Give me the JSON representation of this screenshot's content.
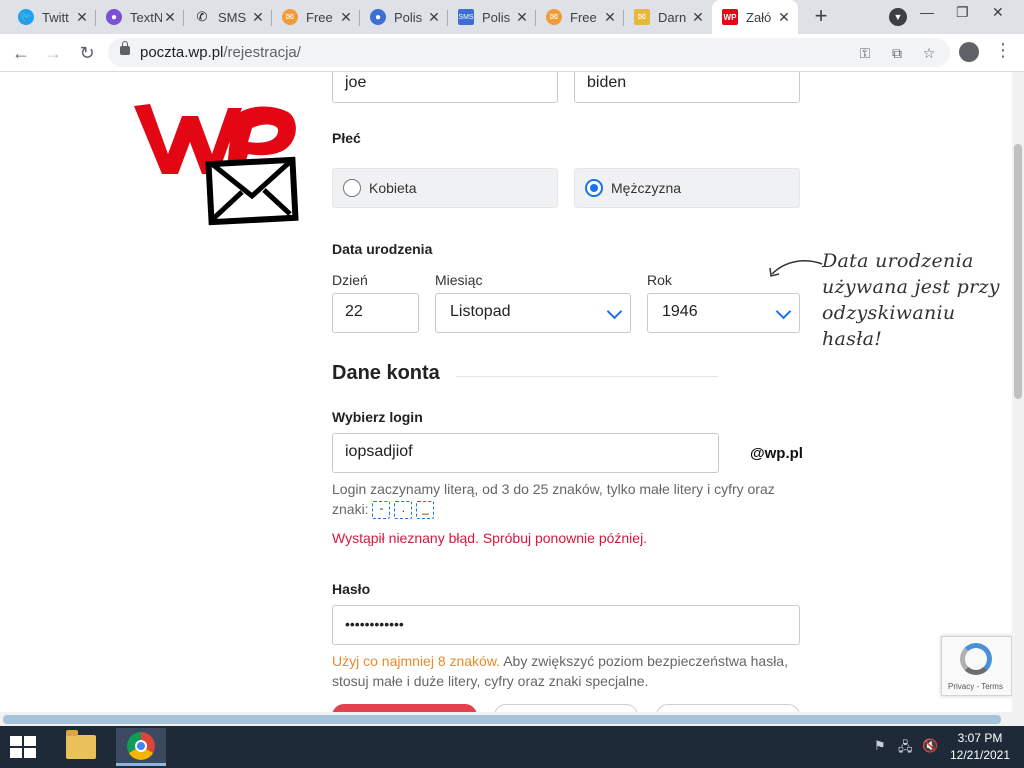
{
  "browser": {
    "tabs": [
      {
        "label": "Twitt",
        "icon": "twitter-icon",
        "color": "#1da1f2"
      },
      {
        "label": "TextN",
        "icon": "textnow-icon",
        "color": "#7b4fd6"
      },
      {
        "label": "SMS",
        "icon": "phone-icon",
        "color": "#222222"
      },
      {
        "label": "Free",
        "icon": "mail-icon",
        "color": "#f29b38"
      },
      {
        "label": "Polis",
        "icon": "chat-icon",
        "color": "#3b6fd4"
      },
      {
        "label": "Polis",
        "icon": "sms-icon",
        "color": "#3b6fd4"
      },
      {
        "label": "Free",
        "icon": "mail-icon",
        "color": "#f29b38"
      },
      {
        "label": "Darn",
        "icon": "envelope-icon",
        "color": "#e8b83a"
      },
      {
        "label": "Załó",
        "icon": "wp-icon",
        "color": "#e30613"
      }
    ],
    "url_host": "poczta.wp.pl",
    "url_path": "/rejestracja/"
  },
  "form": {
    "first_name": "joe",
    "last_name": "biden",
    "gender_label": "Płeć",
    "gender_options": [
      "Kobieta",
      "Mężczyzna"
    ],
    "gender_selected": "Mężczyzna",
    "birth_label": "Data urodzenia",
    "day_label": "Dzień",
    "day_value": "22",
    "month_label": "Miesiąc",
    "month_value": "Listopad",
    "year_label": "Rok",
    "year_value": "1946",
    "birth_note": [
      "Data urodzenia",
      "używana jest przy",
      "odzyskiwaniu hasła!"
    ],
    "section_title": "Dane konta",
    "login_label": "Wybierz login",
    "login_value": "iopsadjiof",
    "domain": "@wp.pl",
    "login_hint": "Login zaczynamy literą, od 3 do 25 znaków, tylko małe litery i cyfry oraz",
    "login_hint2": "znaki:",
    "login_chars": [
      "-",
      ".",
      "_"
    ],
    "login_error": "Wystąpił nieznany błąd. Spróbuj ponownie później.",
    "password_label": "Hasło",
    "password_value": "••••••••••••",
    "password_hint_orange": "Użyj co najmniej 8 znaków.",
    "password_hint_rest": " Aby zwiększyć poziom bezpieczeństwa hasła,",
    "password_hint_line2": "stosuj małe i duże litery, cyfry oraz znaki specjalne."
  },
  "recaptcha": {
    "text": "Privacy - Terms"
  },
  "taskbar": {
    "time": "3:07 PM",
    "date": "12/21/2021"
  },
  "colors": {
    "accent": "#1a73e8",
    "error": "#d6183a",
    "brand": "#e30613",
    "hint_orange": "#e88a2a"
  }
}
